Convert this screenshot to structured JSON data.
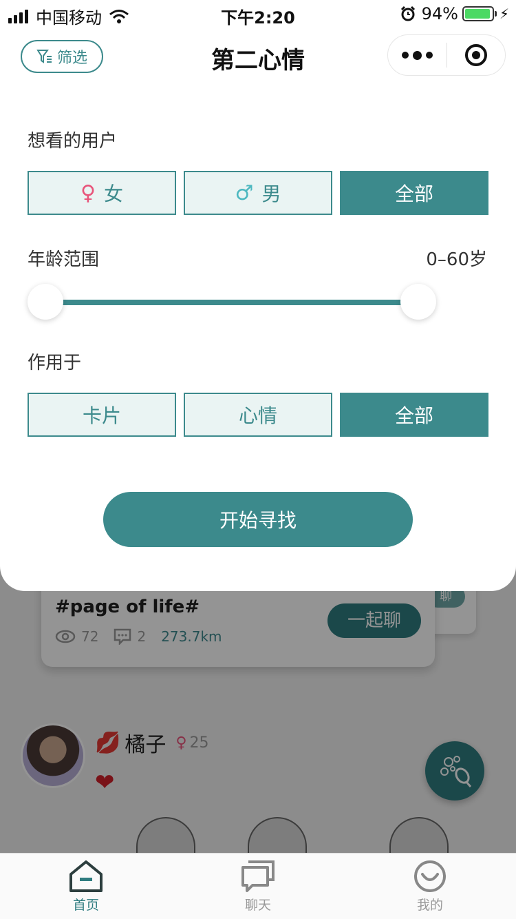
{
  "status_bar": {
    "carrier": "中国移动",
    "time": "下午2:20",
    "battery": "94%",
    "battery_level": 0.94
  },
  "nav": {
    "filter_label": "筛选",
    "title": "第二心情"
  },
  "filter": {
    "users_label": "想看的用户",
    "gender_options": [
      {
        "symbol": "♀",
        "label": "女",
        "symbol_color": "#e8547a"
      },
      {
        "symbol": "♂",
        "label": "男",
        "symbol_color": "#4db8c0"
      },
      {
        "symbol": "",
        "label": "全部"
      }
    ],
    "gender_selected": "全部",
    "age_label": "年龄范围",
    "age_range": "0–60岁",
    "age_min": 0,
    "age_max": 60,
    "apply_label": "作用于",
    "apply_options": [
      {
        "label": "卡片"
      },
      {
        "label": "心情"
      },
      {
        "label": "全部"
      }
    ],
    "apply_selected": "全部",
    "start_label": "开始寻找"
  },
  "feed": {
    "post_title": "#page of life#",
    "views": "72",
    "comments": "2",
    "distance": "273.7km",
    "chat_label": "一起聊",
    "back_chat_label": "聊",
    "user_name": "橘子",
    "user_age": "25",
    "user_gender_symbol": "♀"
  },
  "tabbar": {
    "items": [
      {
        "label": "首页",
        "icon": "home-icon"
      },
      {
        "label": "聊天",
        "icon": "chat-icon"
      },
      {
        "label": "我的",
        "icon": "profile-icon"
      }
    ]
  },
  "colors": {
    "accent": "#3c8a8c",
    "accent_light": "#eaf4f3"
  }
}
